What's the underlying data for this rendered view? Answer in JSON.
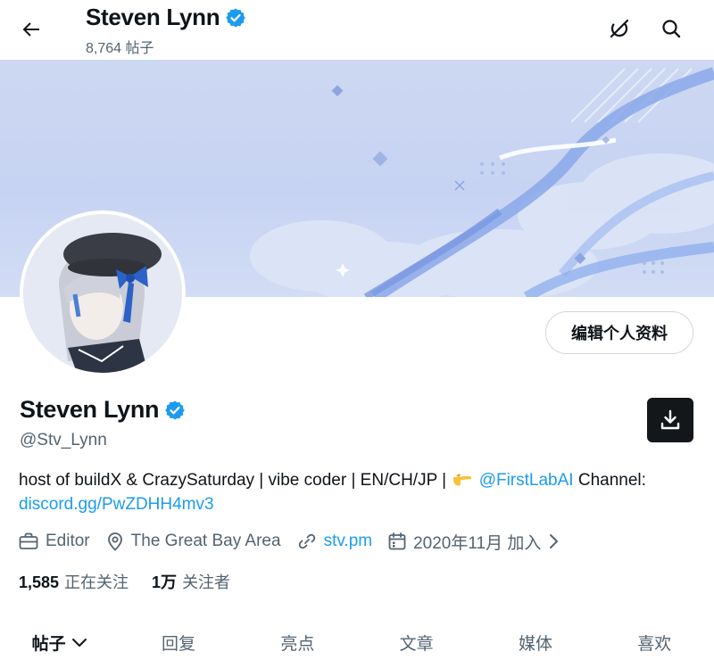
{
  "header": {
    "name": "Steven Lynn",
    "posts_count": "8,764 帖子"
  },
  "profile": {
    "edit_button": "编辑个人资料",
    "name": "Steven Lynn",
    "handle": "@Stv_Lynn",
    "bio_text_1": "host of buildX & CrazySaturday | vibe coder | EN/CH/JP |",
    "bio_mention": "@FirstLabAI",
    "bio_text_2": "Channel:",
    "bio_link": "discord.gg/PwZDHH4mv3",
    "category": "Editor",
    "location": "The Great Bay Area",
    "website": "stv.pm",
    "joined": "2020年11月 加入",
    "following_count": "1,585",
    "following_label": "正在关注",
    "followers_count": "1万",
    "followers_label": "关注者"
  },
  "tabs": [
    {
      "label": "帖子",
      "active": true
    },
    {
      "label": "回复",
      "active": false
    },
    {
      "label": "亮点",
      "active": false
    },
    {
      "label": "文章",
      "active": false
    },
    {
      "label": "媒体",
      "active": false
    },
    {
      "label": "喜欢",
      "active": false
    }
  ],
  "icons": {
    "back": "back-arrow-icon",
    "grok": "grok-icon",
    "search": "search-icon",
    "verified": "verified-badge-icon",
    "download": "download-icon",
    "pointing_hand": "pointing-hand-emoji",
    "briefcase": "briefcase-icon",
    "location": "location-pin-icon",
    "link": "link-icon",
    "calendar": "calendar-icon",
    "chevron": "chevron-right-icon",
    "tab_chevron": "chevron-down-icon"
  },
  "colors": {
    "accent": "#1d9bf0",
    "text": "#0f1419",
    "secondary": "#536471",
    "border": "#cfd9de",
    "banner_bg": "#c6d3f2"
  }
}
